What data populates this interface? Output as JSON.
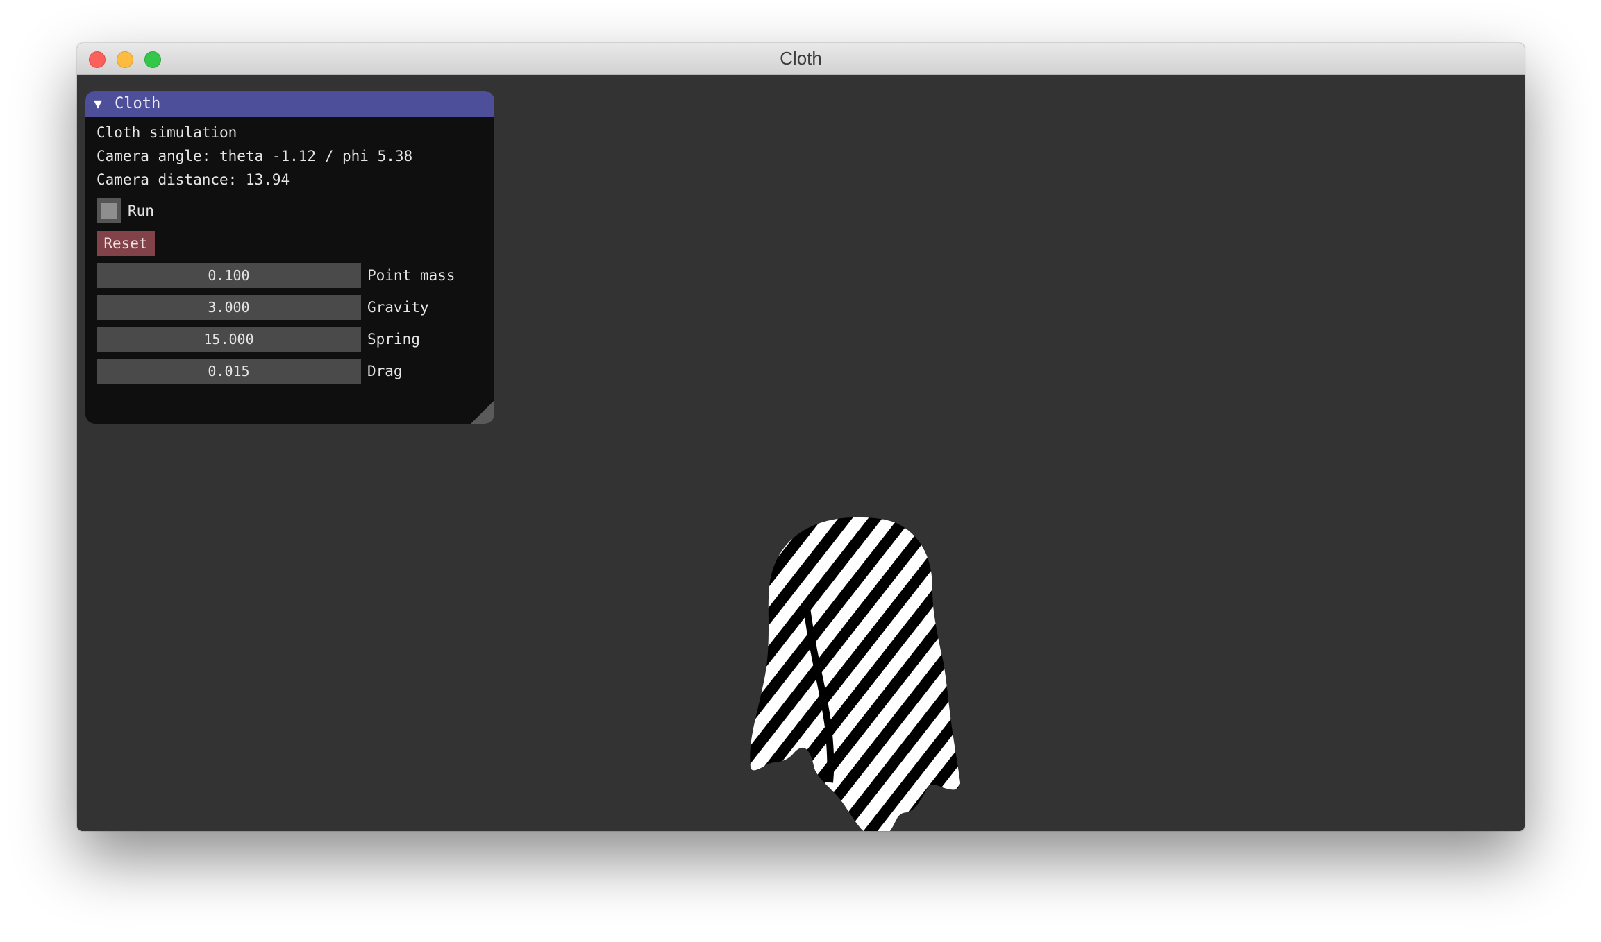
{
  "window": {
    "title": "Cloth",
    "background_color": "#333333"
  },
  "panel": {
    "title": "Cloth",
    "collapse_icon": "triangle-down-icon",
    "header_color": "#4d4f9b",
    "info_lines": [
      "Cloth simulation",
      "Camera angle: theta -1.12 / phi 5.38",
      "Camera distance: 13.94"
    ],
    "run": {
      "label": "Run",
      "checked": false
    },
    "reset_label": "Reset",
    "reset_color": "#814249",
    "sliders": [
      {
        "value": "0.100",
        "label": "Point mass"
      },
      {
        "value": "3.000",
        "label": "Gravity"
      },
      {
        "value": "15.000",
        "label": "Spring"
      },
      {
        "value": "0.015",
        "label": "Drag"
      }
    ]
  },
  "scene": {
    "object": "striped cloth draped over sphere",
    "stripe_colors": [
      "#000000",
      "#ffffff"
    ]
  }
}
